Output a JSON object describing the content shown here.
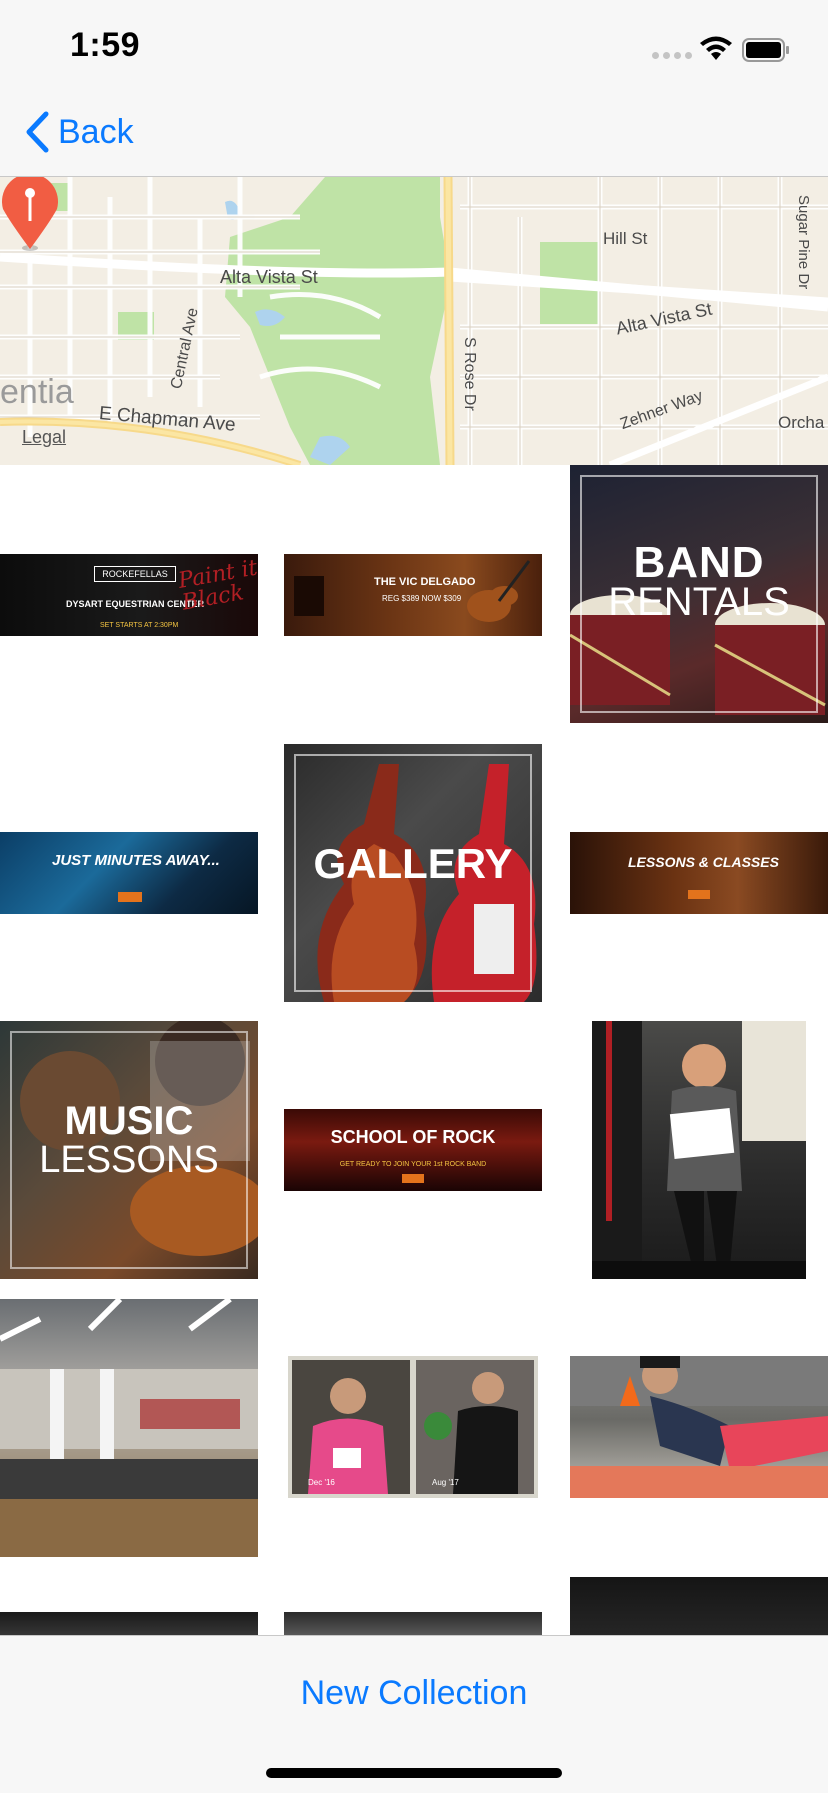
{
  "status_bar": {
    "time": "1:59"
  },
  "nav": {
    "back_label": "Back"
  },
  "map": {
    "streets": [
      "Alta Vista St",
      "Alta Vista St",
      "Central Ave",
      "E Chapman Ave",
      "S Rose Dr",
      "Hill St",
      "Sugar Pine Dr",
      "Zehner Way",
      "Orcha"
    ],
    "area_label": "entia",
    "legal": "Legal"
  },
  "photos": [
    {
      "kind": "banner",
      "lines": [
        "ROCKEFELLAS",
        "DYSART EQUESTRIAN CENTER",
        "SET STARTS AT 2:30PM",
        "Paint it Black"
      ]
    },
    {
      "kind": "banner",
      "lines": [
        "THE VIC DELGADO",
        "REG $389  NOW $309"
      ]
    },
    {
      "kind": "square",
      "lines": [
        "BAND",
        "RENTALS"
      ]
    },
    {
      "kind": "banner",
      "lines": [
        "JUST MINUTES AWAY..."
      ]
    },
    {
      "kind": "square",
      "lines": [
        "GALLERY"
      ]
    },
    {
      "kind": "banner",
      "lines": [
        "LESSONS & CLASSES"
      ]
    },
    {
      "kind": "square",
      "lines": [
        "MUSIC",
        "LESSONS"
      ]
    },
    {
      "kind": "banner",
      "lines": [
        "SCHOOL OF ROCK",
        "GET READY TO JOIN YOUR 1st ROCK BAND"
      ]
    },
    {
      "kind": "photo",
      "lines": []
    },
    {
      "kind": "photo",
      "lines": []
    },
    {
      "kind": "photo",
      "lines": [
        "Dec '16",
        "Aug '17"
      ]
    },
    {
      "kind": "photo",
      "lines": []
    }
  ],
  "toolbar": {
    "new_collection": "New Collection"
  },
  "colors": {
    "accent": "#0a7aff",
    "pin": "#f15d43",
    "map_park": "#bfe3a6",
    "map_bg": "#f3eee4"
  }
}
